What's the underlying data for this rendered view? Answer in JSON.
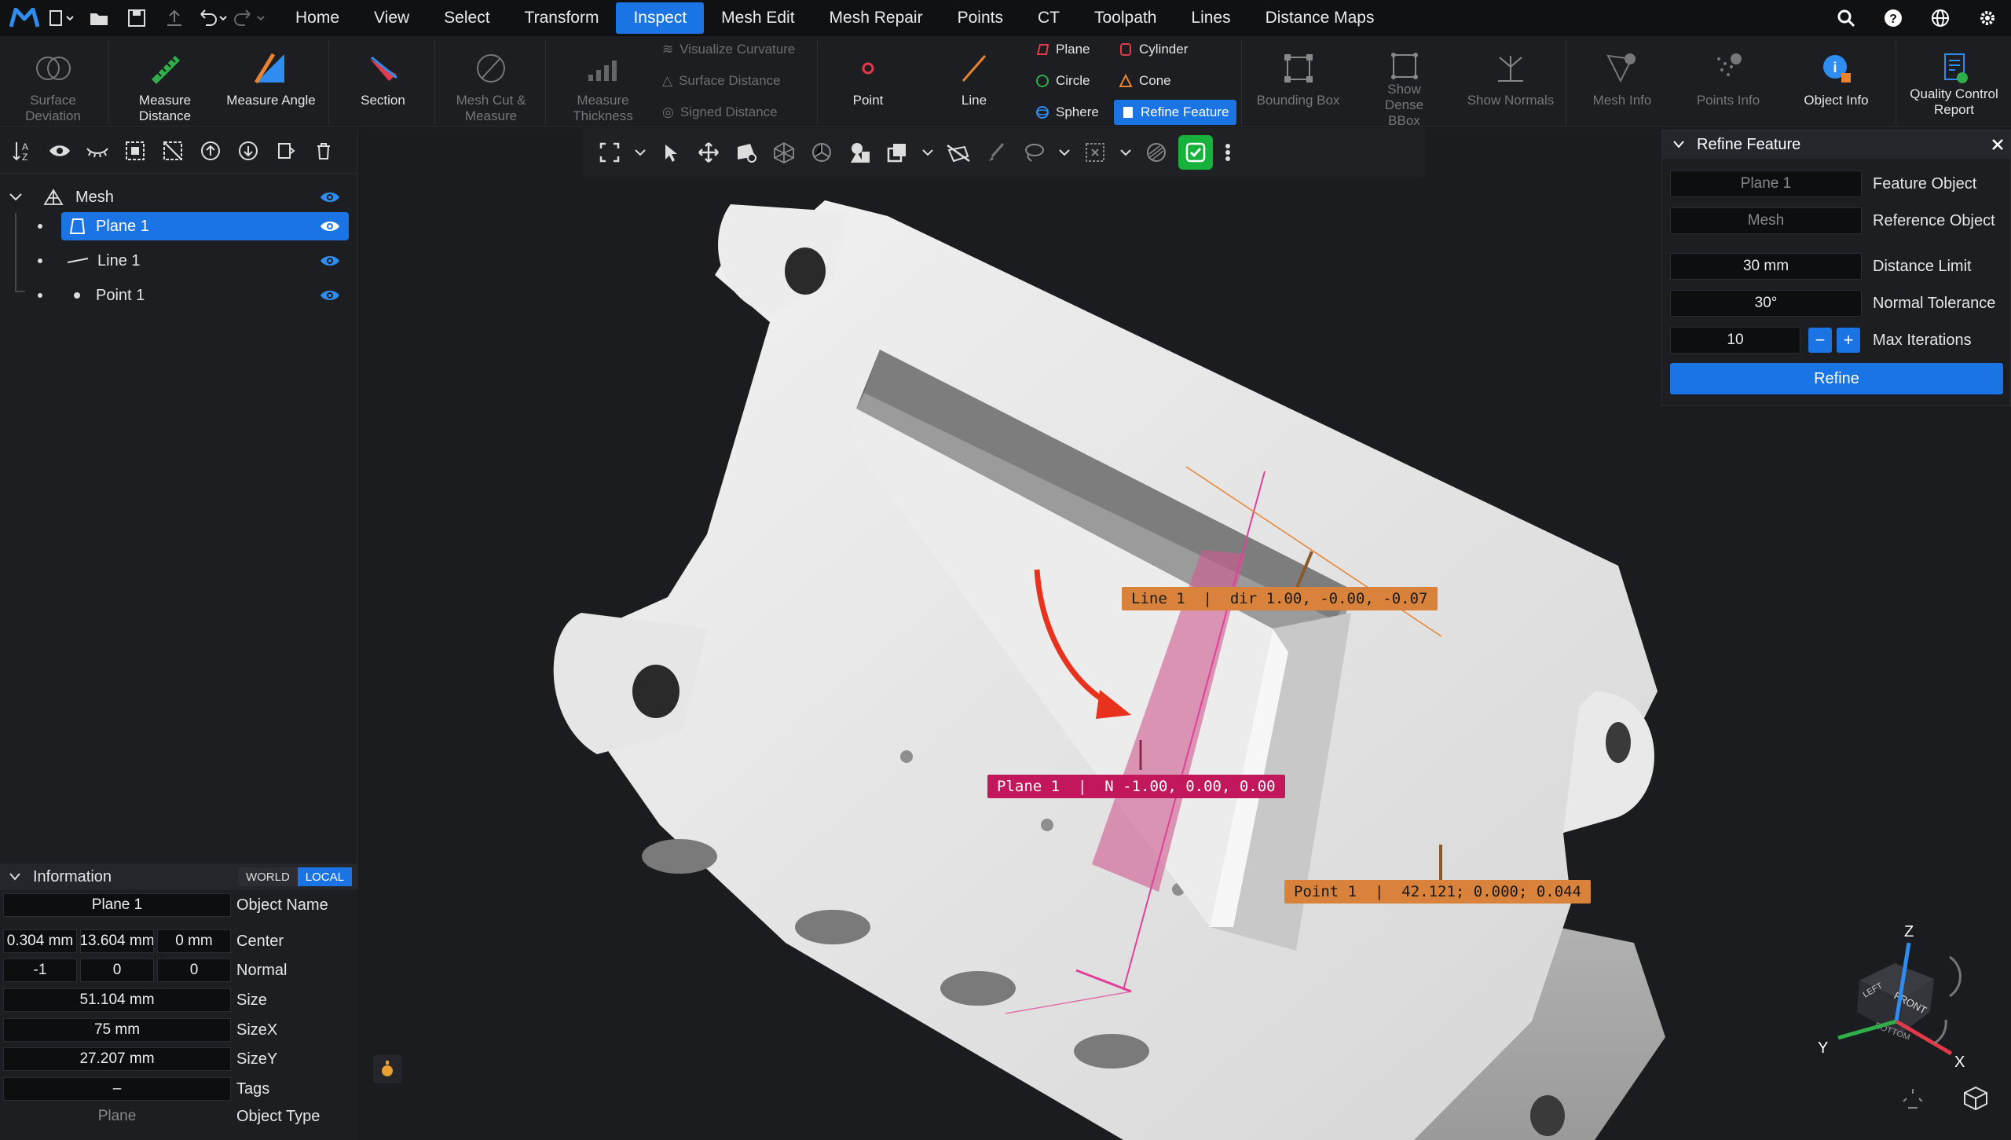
{
  "menu": {
    "tabs": [
      "Home",
      "View",
      "Select",
      "Transform",
      "Inspect",
      "Mesh Edit",
      "Mesh Repair",
      "Points",
      "CT",
      "Toolpath",
      "Lines",
      "Distance Maps"
    ],
    "active_tab": "Inspect"
  },
  "ribbon": {
    "surface_deviation": "Surface Deviation",
    "measure_distance": "Measure Distance",
    "measure_angle": "Measure Angle",
    "section": "Section",
    "mesh_cut": "Mesh Cut & Measure",
    "measure_thickness": "Measure Thickness",
    "visualize_curvature": "Visualize Curvature",
    "surface_distance": "Surface Distance",
    "signed_distance": "Signed Distance",
    "point": "Point",
    "line": "Line",
    "plane": "Plane",
    "circle": "Circle",
    "sphere": "Sphere",
    "cylinder": "Cylinder",
    "cone": "Cone",
    "refine_feature": "Refine Feature",
    "bounding_box": "Bounding Box",
    "show_dense_bbox": "Show Dense BBox",
    "show_normals": "Show Normals",
    "mesh_info": "Mesh Info",
    "points_info": "Points Info",
    "object_info": "Object Info",
    "quality_report": "Quality Control Report"
  },
  "tree": {
    "root": "Mesh",
    "items": [
      {
        "label": "Plane 1",
        "selected": true
      },
      {
        "label": "Line 1",
        "selected": false
      },
      {
        "label": "Point 1",
        "selected": false
      }
    ]
  },
  "info": {
    "title": "Information",
    "world": "WORLD",
    "local": "LOCAL",
    "object_name_value": "Plane 1",
    "object_name_label": "Object Name",
    "center_values": [
      "0.304 mm",
      "13.604 mm",
      "0 mm"
    ],
    "center_label": "Center",
    "normal_values": [
      "-1",
      "0",
      "0"
    ],
    "normal_label": "Normal",
    "size_value": "51.104 mm",
    "size_label": "Size",
    "sizex_value": "75 mm",
    "sizex_label": "SizeX",
    "sizey_value": "27.207 mm",
    "sizey_label": "SizeY",
    "tags_value": "–",
    "tags_label": "Tags",
    "type_value": "Plane",
    "type_label": "Object Type"
  },
  "refine_panel": {
    "title": "Refine Feature",
    "feature_object_value": "Plane 1",
    "feature_object_label": "Feature Object",
    "reference_object_value": "Mesh",
    "reference_object_label": "Reference Object",
    "distance_limit_value": "30 mm",
    "distance_limit_label": "Distance Limit",
    "normal_tolerance_value": "30°",
    "normal_tolerance_label": "Normal Tolerance",
    "max_iterations_value": "10",
    "max_iterations_label": "Max Iterations",
    "minus": "−",
    "plus": "+",
    "refine_button": "Refine"
  },
  "labels": {
    "line": "Line 1  |  dir 1.00, -0.00, -0.07",
    "plane": "Plane 1  |  N -1.00, 0.00, 0.00",
    "point": "Point 1  |  42.121; 0.000; 0.044"
  },
  "axes": {
    "x": "X",
    "y": "Y",
    "z": "Z",
    "front": "FRONT",
    "left": "LEFT",
    "bottom": "BOTTOM"
  },
  "colors": {
    "accent": "#1b74e4",
    "label_orange": "#d9823b",
    "label_magenta": "#c2185b",
    "check_green": "#17b23c",
    "arrow_red": "#e8321e"
  }
}
